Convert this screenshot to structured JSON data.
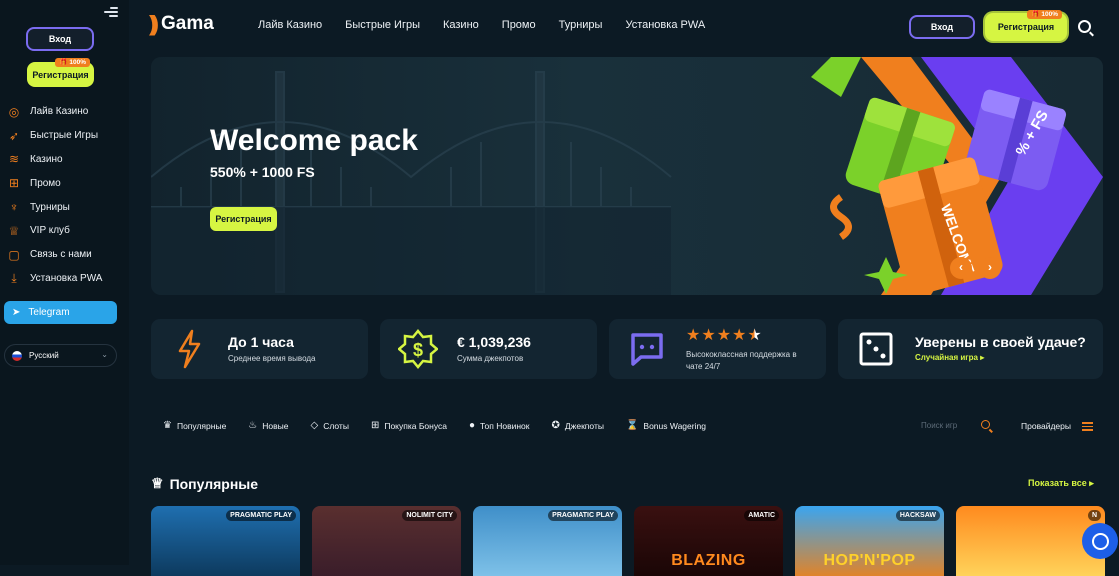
{
  "sidebar": {
    "login_label": "Вход",
    "register_label": "Регистрация",
    "register_badge": "100%",
    "items": [
      {
        "label": "Лайв Казино",
        "icon": "live-casino-icon"
      },
      {
        "label": "Быстрые Игры",
        "icon": "rocket-icon"
      },
      {
        "label": "Казино",
        "icon": "coins-icon"
      },
      {
        "label": "Промо",
        "icon": "gift-icon"
      },
      {
        "label": "Турниры",
        "icon": "trophy-icon"
      },
      {
        "label": "VIP клуб",
        "icon": "vip-icon"
      },
      {
        "label": "Связь с нами",
        "icon": "chat-icon"
      },
      {
        "label": "Установка PWA",
        "icon": "download-icon"
      }
    ],
    "telegram_label": "Telegram",
    "language": "Русский"
  },
  "header": {
    "logo_text": "Gama",
    "nav": [
      "Лайв Казино",
      "Быстрые Игры",
      "Казино",
      "Промо",
      "Турниры",
      "Установка PWA"
    ],
    "login_label": "Вход",
    "register_label": "Регистрация",
    "register_badge": "100%"
  },
  "banner": {
    "title": "Welcome pack",
    "subtitle": "550% + 1000 FS",
    "button_label": "Регистрация",
    "gift_text_1": "% + FS",
    "gift_text_2": "WELCOME"
  },
  "stats": [
    {
      "value": "До 1 часа",
      "label": "Среднее время вывода",
      "icon": "lightning-icon"
    },
    {
      "value": "€ 1,039,236",
      "label": "Сумма джекпотов",
      "icon": "dollar-badge-icon"
    },
    {
      "rating": 4.5,
      "label": "Высококлассная поддержка в чате 24/7",
      "icon": "chat-bubble-icon"
    },
    {
      "value": "Уверены в своей удаче?",
      "label": "Случайная игра",
      "icon": "dice-icon"
    }
  ],
  "filters": [
    {
      "label": "Популярные",
      "icon": "crown-icon"
    },
    {
      "label": "Новые",
      "icon": "flame-icon"
    },
    {
      "label": "Слоты",
      "icon": "diamond-icon"
    },
    {
      "label": "Покупка Бонуса",
      "icon": "gift-icon"
    },
    {
      "label": "Топ Новинок",
      "icon": "drop-icon"
    },
    {
      "label": "Джекпоты",
      "icon": "jackpot-icon"
    },
    {
      "label": "Bonus Wagering",
      "icon": "wagering-icon"
    }
  ],
  "game_search_placeholder": "Поиск игр",
  "providers_label": "Провайдеры",
  "popular": {
    "title": "Популярные",
    "show_all": "Показать все",
    "tiles": [
      {
        "provider": "PRAGMATIC PLAY",
        "title": "",
        "color_top": "#1f6fb0",
        "color_bottom": "#0d3a5e"
      },
      {
        "provider": "NOLIMIT CITY",
        "title": "",
        "color_top": "#5a2f2f",
        "color_bottom": "#3a1d2a"
      },
      {
        "provider": "PRAGMATIC PLAY",
        "title": "",
        "color_top": "#3f8fc9",
        "color_bottom": "#7ec1e8"
      },
      {
        "provider": "AMATIC",
        "title": "BLAZING",
        "color_top": "#3a1010",
        "color_bottom": "#1a0606"
      },
      {
        "provider": "HACKSAW",
        "title": "HOP'N'POP",
        "color_top": "#3aa5f0",
        "color_bottom": "#e0842a"
      },
      {
        "provider": "N",
        "title": "",
        "color_top": "#ff8a1e",
        "color_bottom": "#ffd35a"
      }
    ]
  },
  "colors": {
    "accent": "#d6f542",
    "orange": "#f07f1e",
    "purple": "#7b6cf0",
    "background": "#0c1a24",
    "telegram": "#2aa4e8"
  }
}
